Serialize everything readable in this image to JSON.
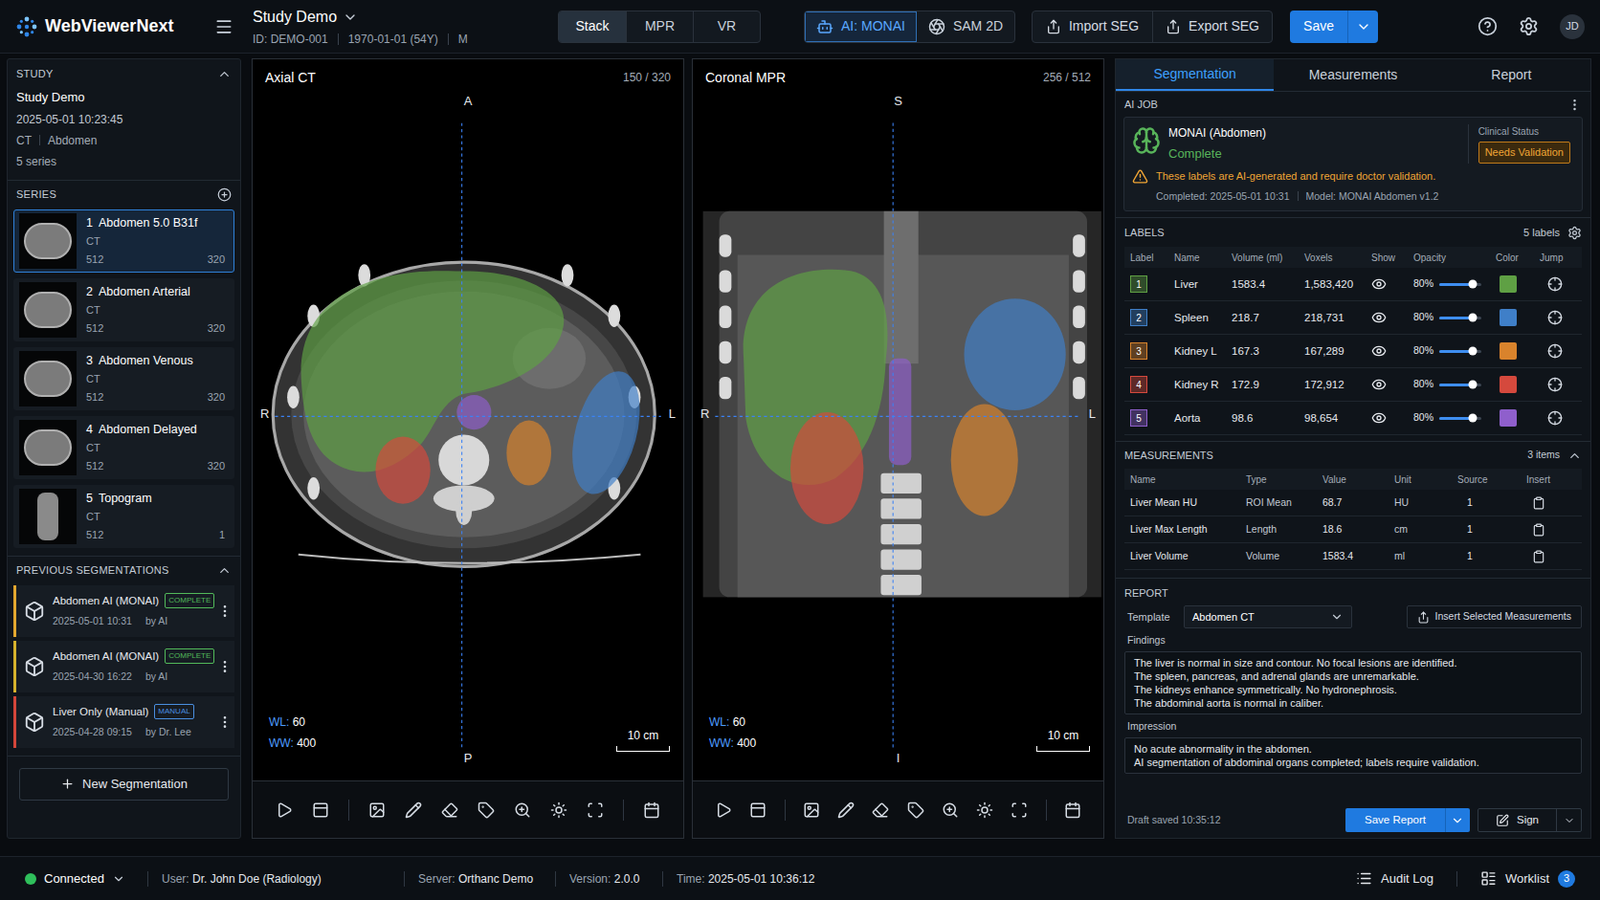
{
  "app": {
    "name": "WebViewerNext",
    "user_initials": "JD"
  },
  "study_header": {
    "title": "Study Demo",
    "id": "ID: DEMO-001",
    "dob": "1970-01-01 (54Y)",
    "sex": "M"
  },
  "view_modes": [
    {
      "label": "Stack",
      "selected": true
    },
    {
      "label": "MPR",
      "selected": false
    },
    {
      "label": "VR",
      "selected": false
    }
  ],
  "ai_tools": [
    {
      "label": "AI: MONAI",
      "selected": true
    },
    {
      "label": "SAM 2D",
      "selected": false
    }
  ],
  "seg_actions": [
    "Import SEG",
    "Export SEG"
  ],
  "save_button": "Save",
  "sidebar": {
    "study": {
      "heading": "STUDY",
      "expanded": true,
      "name": "Study Demo",
      "datetime": "2025-05-01 10:23:45",
      "modality": "CT",
      "body_part": "Abdomen",
      "series_count": "5 series"
    },
    "series_heading": "SERIES",
    "series": [
      {
        "number": "1",
        "name": "Abdomen 5.0 B31f",
        "modality": "CT",
        "matrix": "512",
        "count": "320",
        "selected": true,
        "kind": "axial"
      },
      {
        "number": "2",
        "name": "Abdomen Arterial",
        "modality": "CT",
        "matrix": "512",
        "count": "320",
        "selected": false,
        "kind": "axial"
      },
      {
        "number": "3",
        "name": "Abdomen Venous",
        "modality": "CT",
        "matrix": "512",
        "count": "320",
        "selected": false,
        "kind": "axial"
      },
      {
        "number": "4",
        "name": "Abdomen Delayed",
        "modality": "CT",
        "matrix": "512",
        "count": "320",
        "selected": false,
        "kind": "axial"
      },
      {
        "number": "5",
        "name": "Topogram",
        "modality": "CT",
        "matrix": "512",
        "count": "1",
        "selected": false,
        "kind": "topogram"
      }
    ],
    "previous_heading": "PREVIOUS SEGMENTATIONS",
    "previous_expanded": true,
    "previous": [
      {
        "name": "Abdomen AI (MONAI)",
        "badge": "COMPLETE",
        "badge_color": "#52b95a",
        "date": "2025-05-01 10:31",
        "author": "by AI",
        "color": "#e3a72f"
      },
      {
        "name": "Abdomen AI (MONAI)",
        "badge": "COMPLETE",
        "badge_color": "#52b95a",
        "date": "2025-04-30 16:22",
        "author": "by AI",
        "color": "#d6b22c"
      },
      {
        "name": "Liver Only (Manual)",
        "badge": "MANUAL",
        "badge_color": "#4a8fe0",
        "date": "2025-04-28 09:15",
        "author": "by Dr. Lee",
        "color": "#d4463a"
      }
    ],
    "new_button": "New Segmentation"
  },
  "viewports": [
    {
      "title": "Axial CT",
      "index": "150 / 320",
      "top": "A",
      "bottom": "P",
      "left": "R",
      "right": "L",
      "wl_label": "WL:",
      "wl": "60",
      "ww_label": "WW:",
      "ww": "400",
      "scale": "10 cm",
      "kind": "axial"
    },
    {
      "title": "Coronal MPR",
      "index": "256 / 512",
      "top": "S",
      "bottom": "I",
      "left": "R",
      "right": "L",
      "wl_label": "WL:",
      "wl": "60",
      "ww_label": "WW:",
      "ww": "400",
      "scale": "10 cm",
      "kind": "coronal"
    }
  ],
  "right_panel": {
    "tabs": [
      {
        "label": "Segmentation",
        "selected": true
      },
      {
        "label": "Measurements",
        "selected": false
      },
      {
        "label": "Report",
        "selected": false
      }
    ],
    "ai_job": {
      "heading": "AI JOB",
      "name": "MONAI (Abdomen)",
      "status": "Complete",
      "clinical_label": "Clinical Status",
      "clinical_status": "Needs Validation",
      "warning": "These labels are AI-generated and require doctor validation.",
      "completed": "Completed: 2025-05-01 10:31",
      "model": "Model: MONAI Abdomen v1.2"
    },
    "labels": {
      "heading": "LABELS",
      "count": "5 labels",
      "columns": [
        "Label",
        "Name",
        "Volume (ml)",
        "Voxels",
        "Show",
        "Opacity",
        "Color",
        "Jump"
      ],
      "rows": [
        {
          "number": "1",
          "name": "Liver",
          "volume": "1583.4",
          "voxels": "1,583,420",
          "visible": true,
          "level": 0.8,
          "opacity": "80%",
          "color": "#5fa044"
        },
        {
          "number": "2",
          "name": "Spleen",
          "volume": "218.7",
          "voxels": "218,731",
          "visible": true,
          "level": 0.8,
          "opacity": "80%",
          "color": "#3f7fc8"
        },
        {
          "number": "3",
          "name": "Kidney L",
          "volume": "167.3",
          "voxels": "167,289",
          "visible": true,
          "level": 0.8,
          "opacity": "80%",
          "color": "#d9832c"
        },
        {
          "number": "4",
          "name": "Kidney R",
          "volume": "172.9",
          "voxels": "172,912",
          "visible": true,
          "level": 0.8,
          "opacity": "80%",
          "color": "#d5493d"
        },
        {
          "number": "5",
          "name": "Aorta",
          "volume": "98.6",
          "voxels": "98,654",
          "visible": true,
          "level": 0.8,
          "opacity": "80%",
          "color": "#8f5fcc"
        }
      ]
    },
    "measurements": {
      "heading": "MEASUREMENTS",
      "count": "3 items",
      "expanded": true,
      "columns": [
        "Name",
        "Type",
        "Value",
        "Unit",
        "Source",
        "Insert"
      ],
      "rows": [
        {
          "name": "Liver Mean HU",
          "type": "ROI Mean",
          "value": "68.7",
          "unit": "HU",
          "source": "1"
        },
        {
          "name": "Liver Max Length",
          "type": "Length",
          "value": "18.6",
          "unit": "cm",
          "source": "1"
        },
        {
          "name": "Liver Volume",
          "type": "Volume",
          "value": "1583.4",
          "unit": "ml",
          "source": "1"
        }
      ]
    },
    "report": {
      "heading": "REPORT",
      "template_label": "Template",
      "template": "Abdomen CT",
      "insert_button": "Insert Selected Measurements",
      "findings_label": "Findings",
      "findings": [
        "The liver is normal in size and contour. No focal lesions are identified.",
        "The spleen, pancreas, and adrenal glands are unremarkable.",
        "The kidneys enhance symmetrically. No hydronephrosis.",
        "The abdominal aorta is normal in caliber."
      ],
      "impression_label": "Impression",
      "impression": [
        "No acute abnormality in the abdomen.",
        "AI segmentation of abdominal organs completed; labels require validation."
      ],
      "draft_saved": "Draft saved 10:35:12",
      "save_button": "Save Report",
      "sign_button": "Sign"
    }
  },
  "status_bar": {
    "connection": {
      "label": "Connected",
      "online": true
    },
    "info": [
      {
        "label": "User:",
        "value": "Dr. John Doe (Radiology)"
      },
      {
        "label": "Server:",
        "value": "Orthanc Demo"
      },
      {
        "label": "Version:",
        "value": "2.0.0"
      },
      {
        "label": "Time:",
        "value": "2025-05-01 10:36:12"
      }
    ],
    "audit": "Audit Log",
    "worklist": {
      "label": "Worklist",
      "count": "3"
    }
  }
}
